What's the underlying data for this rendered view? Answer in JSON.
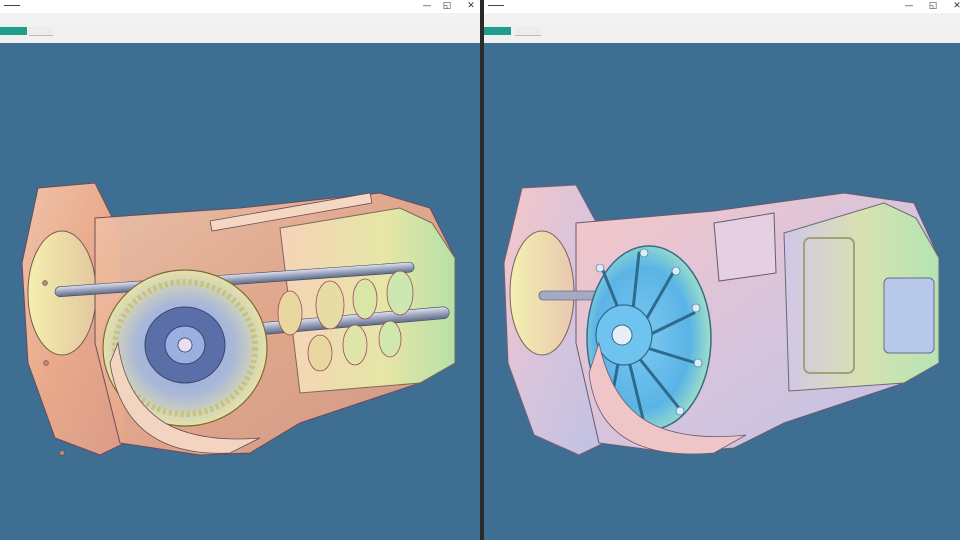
{
  "colors": {
    "viewport_background": "#3f6e93",
    "active_tab": "#1e9e8b",
    "divider": "#2a2a2a"
  },
  "left_window": {
    "controls": {
      "minimize": "—",
      "maximize": "◱",
      "close": "✕"
    },
    "tabs": [
      {
        "label": "",
        "active": true
      },
      {
        "label": "",
        "active": false
      }
    ],
    "viewport": {
      "model": "transmission-cutaway",
      "render_mode": "section-view-with-internal-gears"
    }
  },
  "right_window": {
    "controls": {
      "minimize": "—",
      "maximize": "◱",
      "close": "✕"
    },
    "tabs": [
      {
        "label": "",
        "active": true
      },
      {
        "label": "",
        "active": false
      }
    ],
    "viewport": {
      "model": "transmission-housing",
      "render_mode": "shaded-housing-exterior"
    }
  }
}
